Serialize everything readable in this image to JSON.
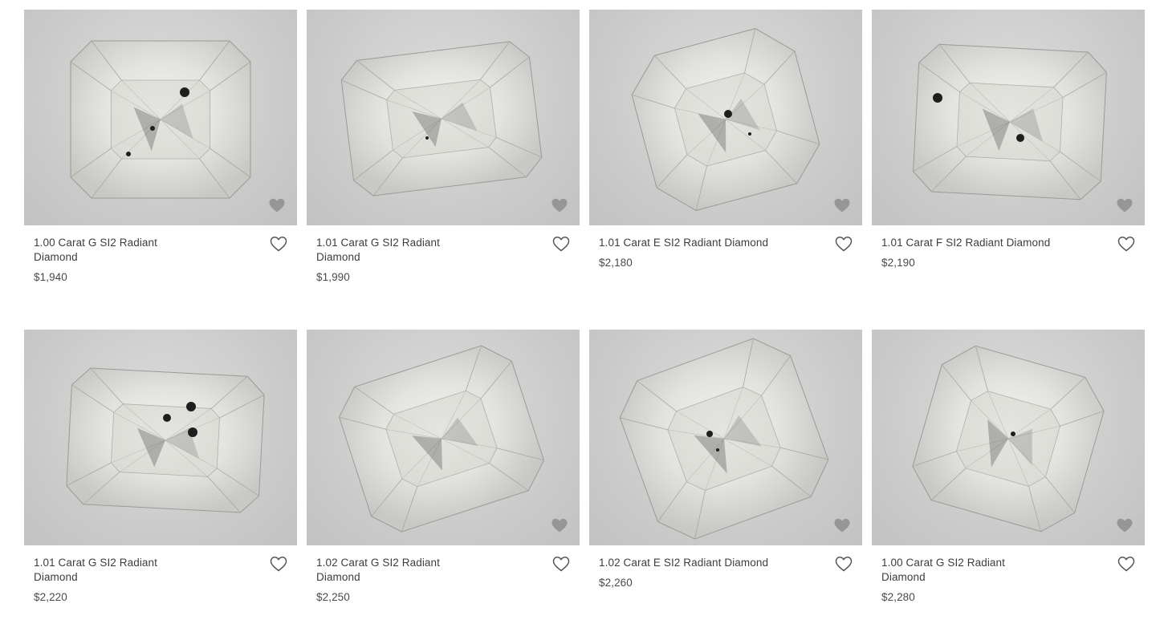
{
  "colors": {
    "image_background": "#c9c9c9",
    "text": "#3d3d3d",
    "heart_outline": "#555555",
    "watermark": "#8a8a8a"
  },
  "icons": {
    "favorite": "heart-outline-icon",
    "watermark": "heart-watermark-icon"
  },
  "products": [
    {
      "title": "1.00 Carat G SI2 Radiant Diamond",
      "price": "$1,940",
      "watermark": true
    },
    {
      "title": "1.01 Carat G SI2 Radiant Diamond",
      "price": "$1,990",
      "watermark": true
    },
    {
      "title": "1.01 Carat E SI2 Radiant Diamond",
      "price": "$2,180",
      "watermark": true
    },
    {
      "title": "1.01 Carat F SI2 Radiant Diamond",
      "price": "$2,190",
      "watermark": true
    },
    {
      "title": "1.01 Carat G SI2 Radiant Diamond",
      "price": "$2,220",
      "watermark": false
    },
    {
      "title": "1.02 Carat G SI2 Radiant Diamond",
      "price": "$2,250",
      "watermark": true
    },
    {
      "title": "1.02 Carat E SI2 Radiant Diamond",
      "price": "$2,260",
      "watermark": true
    },
    {
      "title": "1.00 Carat G SI2 Radiant Diamond",
      "price": "$2,280",
      "watermark": true
    }
  ]
}
